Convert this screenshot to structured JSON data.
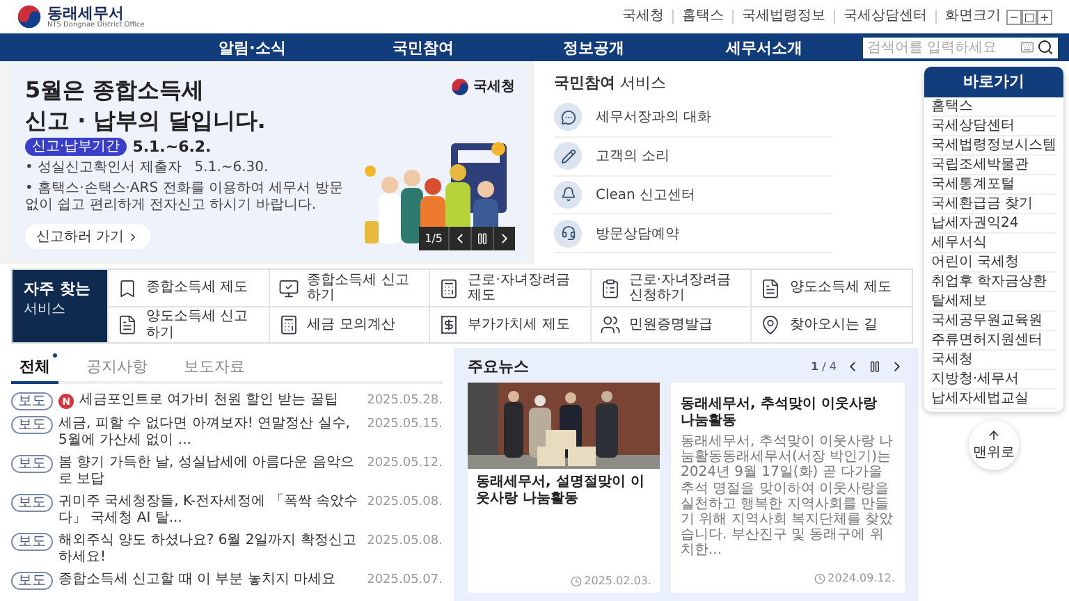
{
  "header": {
    "logo": {
      "name": "동래세무서",
      "subtitle": "NTS Dongnae District Office"
    },
    "util_links": [
      "국세청",
      "홈택스",
      "국세법령정보",
      "국세상담센터"
    ],
    "font_size": {
      "label": "화면크기",
      "buttons": [
        "−",
        "□",
        "+"
      ]
    }
  },
  "nav": {
    "items": [
      "알림·소식",
      "국민참여",
      "정보공개",
      "세무서소개"
    ],
    "search": {
      "placeholder": "검색어를 입력하세요"
    }
  },
  "banner": {
    "title_lines": [
      "5월은 **종합소득세**",
      "**신고** · **납부**의 달입니다."
    ],
    "logo": "국세청",
    "period_badge": "신고·납부기간",
    "period": "5.1.~6.2.",
    "bullets": [
      "• 성실신고확인서 제출자   5.1.~6.30.",
      "• 홈택스·손택스·ARS 전화를 이용하여 세무서 방문 없이 쉽고 편리하게 전자신고 하시기 바랍니다."
    ],
    "button": "신고하러 가기",
    "counter": "1/5"
  },
  "participation": {
    "title": "**국민참여** 서비스",
    "items": [
      "세무서장과의 대화",
      "고객의 소리",
      "Clean 신고센터",
      "방문상담예약"
    ]
  },
  "frequent_services": {
    "title": "자주 찾는",
    "subtitle": "서비스",
    "items": [
      "종합소득세 제도",
      "종합소득세 신고하기",
      "근로·자녀장려금 제도",
      "근로·자녀장려금 신청하기",
      "양도소득세 제도",
      "양도소득세 신고하기",
      "세금 모의계산",
      "부가가치세 제도",
      "민원증명발급",
      "찾아오시는 길"
    ]
  },
  "notices": {
    "tabs": [
      {
        "label": "전체",
        "selected": true
      },
      {
        "label": "공지사항",
        "selected": false
      },
      {
        "label": "보도자료",
        "selected": false
      }
    ],
    "rows": [
      {
        "badge": "보도",
        "new_mark": "N",
        "title": "세금포인트로 여가비 천원 할인 받는 꿀팁",
        "date": "2025.05.28."
      },
      {
        "badge": "보도",
        "title": "세금, 피할 수 없다면 아껴보자! 연말정산 실수, 5월에 가산세 없이 ...",
        "date": "2025.05.15."
      },
      {
        "badge": "보도",
        "title": "봄 향기 가득한 날, 성실납세에 아름다운 음악으로 보답",
        "date": "2025.05.12."
      },
      {
        "badge": "보도",
        "title": "귀미주 국세청장들, K-전자세정에 「폭싹 속았수다」 국세청 AI 탈...",
        "date": "2025.05.08."
      },
      {
        "badge": "보도",
        "title": "해외주식 양도 하셨나요? 6월 2일까지 확정신고 하세요!",
        "date": "2025.05.08."
      },
      {
        "badge": "보도",
        "title": "종합소득세 신고할 때 이 부분 놓치지 마세요",
        "date": "2025.05.07."
      }
    ]
  },
  "news": {
    "title": "주요뉴스",
    "counter": "**1** / 4",
    "cards": [
      {
        "title": "동래세무서, 설명절맞이 이웃사랑 나눔활동",
        "date": "2025.02.03."
      },
      {
        "kind": "text",
        "title": "동래세무서, 추석맞이 이웃사랑 나눔활동",
        "body": "동래세무서, 추석맞이 이웃사랑 나눔활동동래세무서(서장 박인기)는 2024년 9월 17일(화) 곧 다가올 추석 명절을 맞이하여 이웃사랑을 실천하고 행복한 지역사회를 만들기 위해 지역사회 복지단체를 찾았습니다. 부산진구 및 동래구에 위치한...",
        "date": "2024.09.12."
      }
    ]
  },
  "quick_links": {
    "title": "바로가기",
    "items": [
      "홈택스",
      "국세상담센터",
      "국세법령정보시스템",
      "국립조세박물관",
      "국세통계포털",
      "국세환급금 찾기",
      "납세자권익24",
      "세무서식",
      "어린이 국세청",
      "취업후 학자금상환",
      "탈세제보",
      "국세공무원교육원",
      "주류면허지원센터",
      "국세청",
      "지방청·세무서",
      "납세자세법교실"
    ]
  },
  "top_button": "맨위로"
}
